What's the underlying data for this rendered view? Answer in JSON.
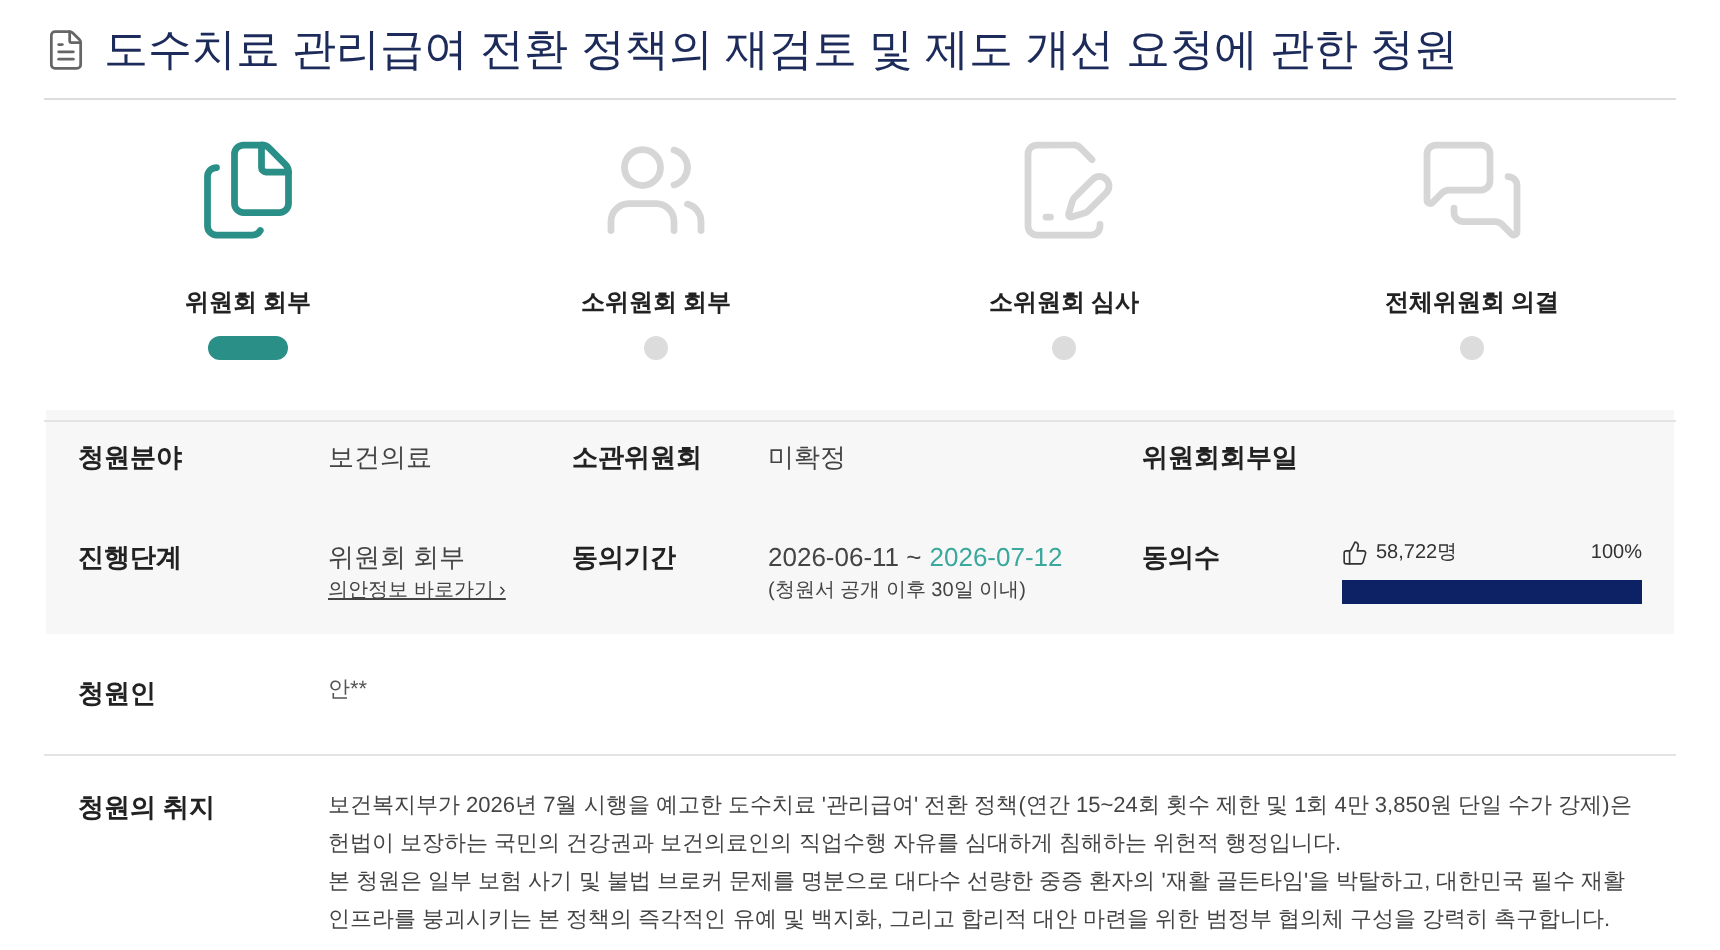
{
  "title": "도수치료 관리급여 전환 정책의 재검토 및 제도 개선 요청에 관한 청원",
  "steps": [
    {
      "label": "위원회 회부",
      "selected": true
    },
    {
      "label": "소위원회 회부",
      "selected": false
    },
    {
      "label": "소위원회 심사",
      "selected": false
    },
    {
      "label": "전체위원회 의결",
      "selected": false
    }
  ],
  "info": {
    "field_label": "청원분야",
    "field": "보건의료",
    "committee_label": "소관위원회",
    "committee": "미확정",
    "referral_date_label": "위원회회부일",
    "stage_label": "진행단계",
    "stage": "위원회 회부",
    "bill_link": "의안정보 바로가기 ›",
    "period_label": "동의기간",
    "period_start": "2026-06-11 ~",
    "period_end": "2026-07-12",
    "period_note": "(청원서 공개 이후 30일 이내)",
    "agree_label": "동의수",
    "agree_count": "58,722명",
    "agree_percent": "100%",
    "level": 1.0
  },
  "petitioner_label": "청원인",
  "petitioner": "안**",
  "purpose_label": "청원의 취지",
  "purpose": [
    "보건복지부가 2026년 7월 시행을 예고한 도수치료 '관리급여' 전환 정책(연간 15~24회 횟수 제한 및 1회 4만 3,850원 단일 수가 강제)은 헌법이 보장하는 국민의 건강권과 보건의료인의 직업수행 자유를 심대하게 침해하는 위헌적 행정입니다.",
    "본 청원은 일부 보험 사기 및 불법 브로커 문제를 명분으로 대다수 선량한 중증 환자의 '재활 골든타임'을 박탈하고, 대한민국 필수 재활 인프라를 붕괴시키는 본 정책의 즉각적인 유예 및 백지화, 그리고 합리적 대안 마련을 위한 범정부 협의체 구성을 강력히 촉구합니다."
  ]
}
